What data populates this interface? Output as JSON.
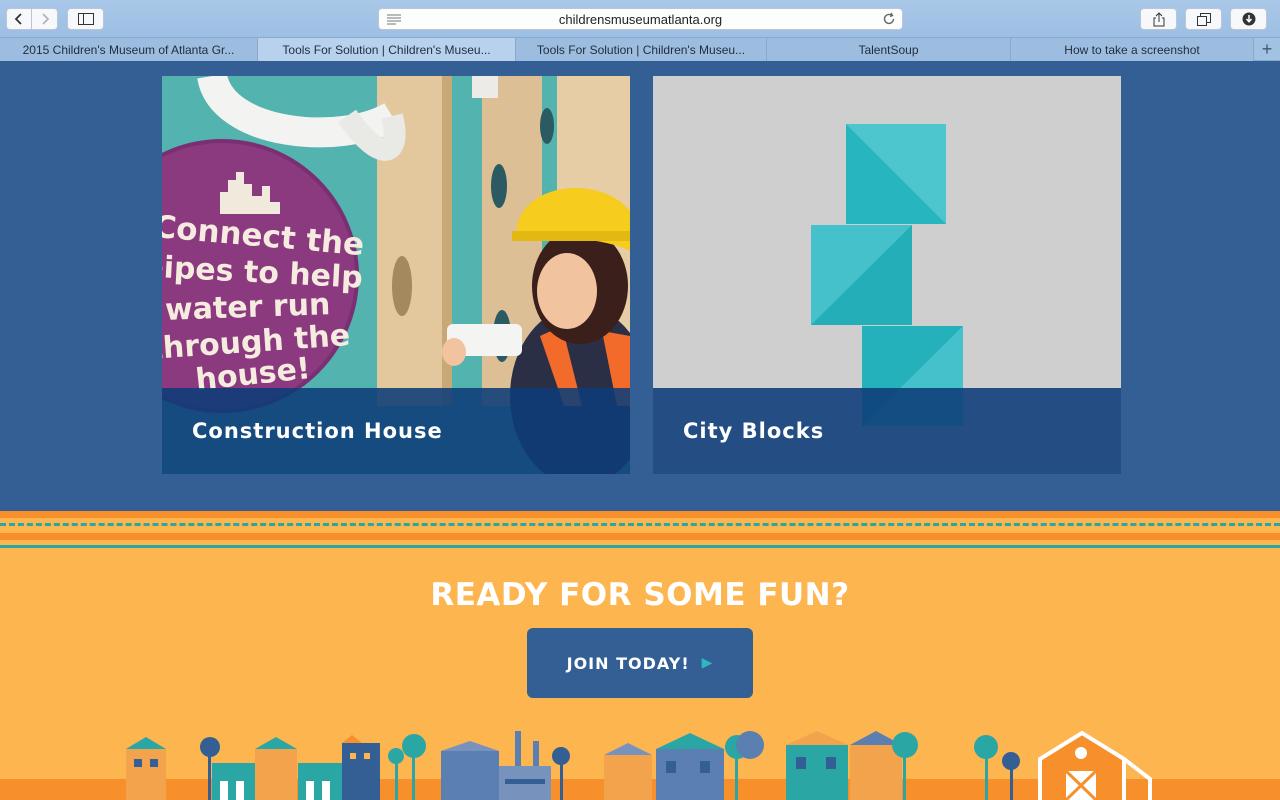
{
  "browser": {
    "url": "childrensmuseumatlanta.org",
    "tabs": [
      {
        "label": "2015 Children's Museum of Atlanta Gr...",
        "active": false
      },
      {
        "label": "Tools For Solution | Children's Museu...",
        "active": true
      },
      {
        "label": "Tools For Solution | Children's Museu...",
        "active": false
      },
      {
        "label": "TalentSoup",
        "active": false
      },
      {
        "label": "How to take a screenshot",
        "active": false
      }
    ]
  },
  "cards": [
    {
      "title": "Construction House",
      "sign_lines": [
        "Connect the",
        "pipes to help",
        "water run",
        "through the",
        "house!"
      ]
    },
    {
      "title": "City Blocks"
    }
  ],
  "promo": {
    "heading": "READY FOR SOME FUN?",
    "button_label": "JOIN TODAY!"
  },
  "colors": {
    "content_blue": "#335f94",
    "caption_blue": "#0c3c78",
    "promo_orange": "#fdb54f",
    "stripe_orange": "#f78f2b",
    "teal": "#2aa6a5",
    "block_teal": "#41c2cc"
  }
}
